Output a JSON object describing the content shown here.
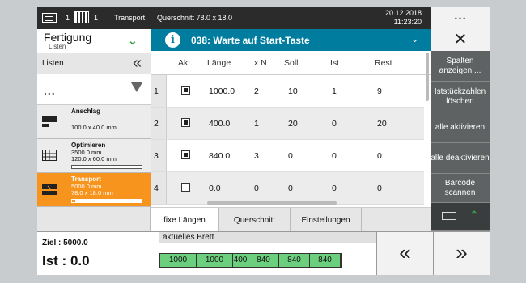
{
  "status": {
    "counter1": "1",
    "counter2": "1",
    "mode": "Transport",
    "cross_section": "Querschnitt 78.0 x 18.0",
    "date": "20.12.2018",
    "time": "11:23:20",
    "menu_label": "...",
    "icon1": "sheet-icon",
    "icon2": "grid-icon"
  },
  "left": {
    "title": "Fertigung",
    "subtitle": "Listen",
    "lists_label": "Listen",
    "collapse_icon": "«",
    "dots": "...",
    "items": [
      {
        "name": "Anschlag",
        "lines": [
          "",
          "100.0 x 40.0 mm"
        ],
        "progress": null
      },
      {
        "name": "Optimieren",
        "lines": [
          "3500.0 mm",
          "120.0 x 60.0 mm"
        ],
        "progress": 0.0
      },
      {
        "name": "Transport",
        "lines": [
          "5000.0 mm",
          "78.0 x 18.0 mm"
        ],
        "progress": 0.05
      }
    ]
  },
  "message": {
    "icon": "i",
    "text": "038: Warte auf Start-Taste",
    "close": "✕"
  },
  "table": {
    "headers": [
      "Akt.",
      "Länge",
      "x N",
      "Soll",
      "Ist",
      "Rest"
    ],
    "rows": [
      {
        "no": "1",
        "active": true,
        "laenge": "1000.0",
        "n": "2",
        "soll": "10",
        "ist": "1",
        "rest": "9"
      },
      {
        "no": "2",
        "active": true,
        "laenge": "400.0",
        "n": "1",
        "soll": "20",
        "ist": "0",
        "rest": "20"
      },
      {
        "no": "3",
        "active": true,
        "laenge": "840.0",
        "n": "3",
        "soll": "0",
        "ist": "0",
        "rest": "0"
      },
      {
        "no": "4",
        "active": false,
        "laenge": "0.0",
        "n": "0",
        "soll": "0",
        "ist": "0",
        "rest": "0"
      }
    ]
  },
  "tabs": [
    "fixe Längen",
    "Querschnitt",
    "Einstellungen"
  ],
  "right_buttons": [
    "Spalten anzeigen ...",
    "Iststückzahlen löschen",
    "alle aktivieren",
    "alle deaktivieren",
    "Barcode scannen"
  ],
  "bottom": {
    "ziel": "Ziel : 5000.0",
    "ist": "Ist : 0.0",
    "brett_label": "aktuelles Brett",
    "segments": [
      "1000",
      "1000",
      "400",
      "840",
      "840",
      "840"
    ],
    "prev": "«",
    "next": "»"
  },
  "colors": {
    "accent": "#007c9e",
    "selected": "#f7941d",
    "segment_fill": "#6ccf7e",
    "button_bg": "#5e6262"
  }
}
